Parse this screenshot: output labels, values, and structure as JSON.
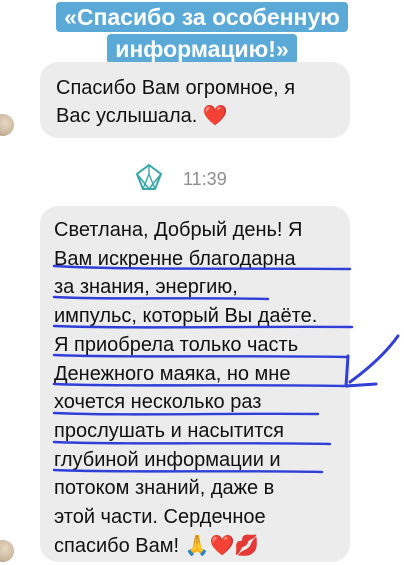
{
  "header": {
    "title_line1": "«Спасибо за особенную",
    "title_line2": "информацию!»",
    "bg_color": "#5aa9d6"
  },
  "messages": [
    {
      "lines": [
        "Спасибо Вам огромное, я",
        "Вас услышала. ❤️"
      ]
    },
    {
      "lines": [
        "Светлана, Добрый день! Я",
        "Вам искренне благодарна",
        "за знания, энергию,",
        "импульс, который Вы даёте.",
        "Я приобрела только часть",
        "Денежного маяка, но мне",
        "хочется несколько раз",
        "прослушать и насытится",
        "глубиной информации и",
        "потоком знаний, даже в",
        "этой части. Сердечное",
        "спасибо Вам! 🙏❤️💋"
      ]
    }
  ],
  "timestamp": "11:39",
  "icons": {
    "sender_logo": "diamond-logo-icon",
    "annotation_arrow": "arrow-annotation-icon"
  },
  "colors": {
    "underline": "#2f3fd8",
    "bubble_bg": "#ececec"
  }
}
